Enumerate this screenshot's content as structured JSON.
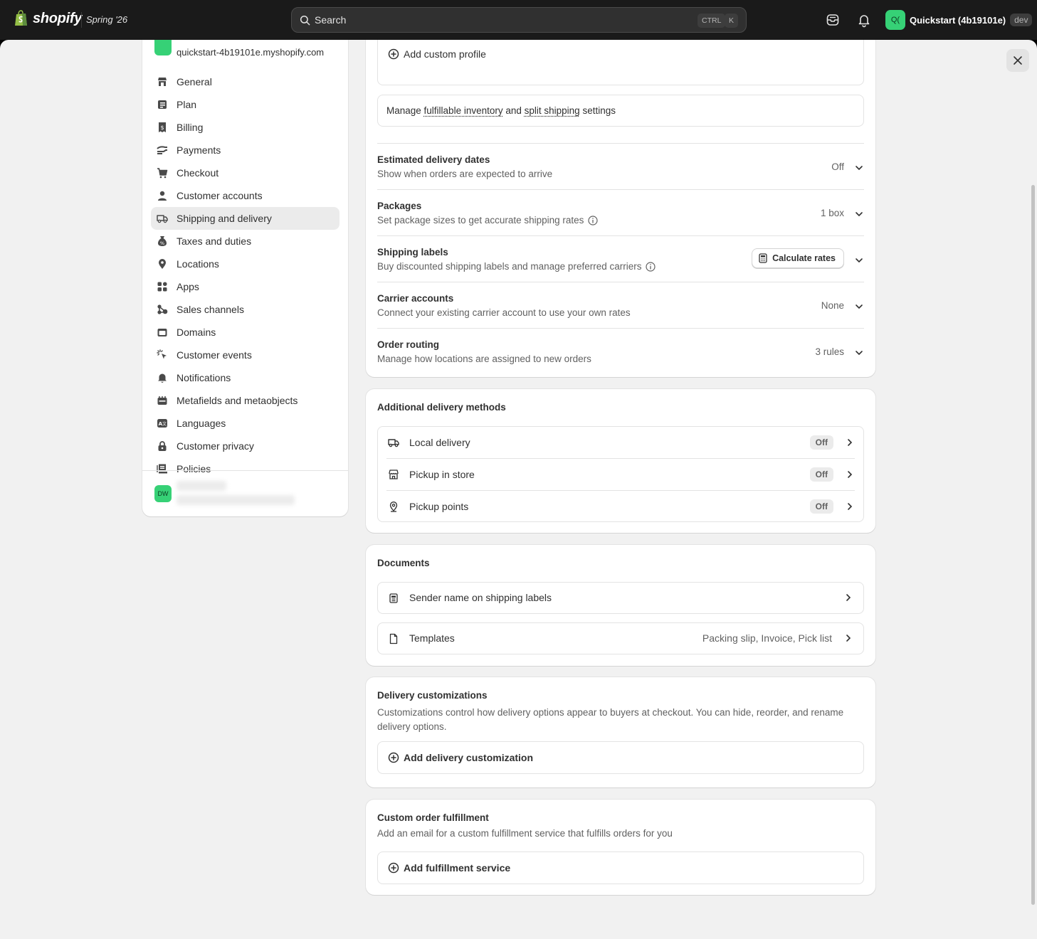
{
  "topbar": {
    "brand": "shopify",
    "edition": "Spring '26",
    "search_placeholder": "Search",
    "kbd_ctrl": "CTRL",
    "kbd_k": "K",
    "store_initials": "Q(",
    "store_name": "Quickstart (4b19101e)",
    "dev_badge": "dev"
  },
  "sidebar": {
    "store_url": "quickstart-4b19101e.myshopify.com",
    "items": [
      {
        "label": "General",
        "icon": "store-icon"
      },
      {
        "label": "Plan",
        "icon": "plan-icon"
      },
      {
        "label": "Billing",
        "icon": "billing-icon"
      },
      {
        "label": "Payments",
        "icon": "payments-icon"
      },
      {
        "label": "Checkout",
        "icon": "cart-icon"
      },
      {
        "label": "Customer accounts",
        "icon": "person-icon"
      },
      {
        "label": "Shipping and delivery",
        "icon": "truck-icon",
        "active": true
      },
      {
        "label": "Taxes and duties",
        "icon": "tax-icon"
      },
      {
        "label": "Locations",
        "icon": "location-icon"
      },
      {
        "label": "Apps",
        "icon": "apps-icon"
      },
      {
        "label": "Sales channels",
        "icon": "channels-icon"
      },
      {
        "label": "Domains",
        "icon": "domains-icon"
      },
      {
        "label": "Customer events",
        "icon": "cursor-icon"
      },
      {
        "label": "Notifications",
        "icon": "bell-icon"
      },
      {
        "label": "Metafields and metaobjects",
        "icon": "metafields-icon"
      },
      {
        "label": "Languages",
        "icon": "language-icon"
      },
      {
        "label": "Customer privacy",
        "icon": "lock-icon"
      },
      {
        "label": "Policies",
        "icon": "policies-icon"
      }
    ],
    "user_initials": "DW"
  },
  "shipping_card": {
    "add_custom_profile": "Add custom profile",
    "manage_text_pre": "Manage ",
    "manage_link1": "fulfillable inventory",
    "manage_text_mid": " and ",
    "manage_link2": "split shipping",
    "manage_text_post": " settings",
    "rows": [
      {
        "title": "Estimated delivery dates",
        "subtitle": "Show when orders are expected to arrive",
        "value": "Off"
      },
      {
        "title": "Packages",
        "subtitle": "Set package sizes to get accurate shipping rates",
        "value": "1 box"
      },
      {
        "title": "Shipping labels",
        "subtitle": "Buy discounted shipping labels and manage preferred carriers",
        "button": "Calculate rates"
      },
      {
        "title": "Carrier accounts",
        "subtitle": "Connect your existing carrier account to use your own rates",
        "value": "None"
      },
      {
        "title": "Order routing",
        "subtitle": "Manage how locations are assigned to new orders",
        "value": "3 rules"
      }
    ]
  },
  "additional_methods": {
    "title": "Additional delivery methods",
    "items": [
      {
        "label": "Local delivery",
        "status": "Off",
        "icon": "truck-icon"
      },
      {
        "label": "Pickup in store",
        "status": "Off",
        "icon": "store-icon"
      },
      {
        "label": "Pickup points",
        "status": "Off",
        "icon": "location-pin-icon"
      }
    ]
  },
  "documents": {
    "title": "Documents",
    "items": [
      {
        "label": "Sender name on shipping labels",
        "value": "",
        "icon": "label-icon"
      },
      {
        "label": "Templates",
        "value": "Packing slip, Invoice, Pick list",
        "icon": "file-icon"
      }
    ]
  },
  "delivery_customizations": {
    "title": "Delivery customizations",
    "description": "Customizations control how delivery options appear to buyers at checkout. You can hide, reorder, and rename delivery options.",
    "add_label": "Add delivery customization"
  },
  "custom_fulfillment": {
    "title": "Custom order fulfillment",
    "description": "Add an email for a custom fulfillment service that fulfills orders for you",
    "add_label": "Add fulfillment service"
  },
  "colors": {
    "topbar_bg": "#1a1a1a",
    "panel_bg": "#f1f1f1",
    "accent_green": "#36d176",
    "text": "#303030",
    "muted": "#616161"
  }
}
